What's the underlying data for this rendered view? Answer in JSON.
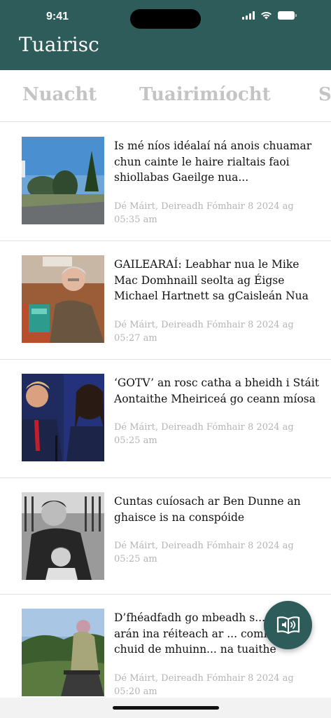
{
  "status": {
    "time": "9:41"
  },
  "header": {
    "title": "Tuairisc"
  },
  "tabs": [
    {
      "label": "Nuacht"
    },
    {
      "label": "Tuairimíocht"
    },
    {
      "label": "Sp"
    }
  ],
  "articles": [
    {
      "title": "Is mé níos idéalaí ná anois chuamar chun cainte le haire rialtais faoi shiollabas Gaeilge nua...",
      "date": "Dé Máirt, Deireadh Fómhair 8 2024 ag 05:35 am"
    },
    {
      "title": "GAILEARAÍ: Leabhar nua le Mike Mac Domhnaill seolta ag Éigse Michael Hartnett sa gCaisleán Nua",
      "date": "Dé Máirt, Deireadh Fómhair 8 2024 ag 05:27 am"
    },
    {
      "title": "‘GOTV’ an rosc catha a bheidh i Stáit Aontaithe Mheiriceá go ceann míosa",
      "date": "Dé Máirt, Deireadh Fómhair 8 2024 ag 05:25 am"
    },
    {
      "title": "Cuntas cuíosach ar Ben Dunne an ghaisce is na conspóide",
      "date": "Dé Máirt, Deireadh Fómhair 8 2024 ag 05:25 am"
    },
    {
      "title": "D’fhéadfadh go mbeadh s... agus arán ina réiteach ar ... comhluadair chuid de mhuinn... na tuaithe",
      "date": "Dé Máirt, Deireadh Fómhair 8 2024 ag 05:20 am"
    }
  ],
  "fab": {
    "icon": "book-audio-icon"
  },
  "colors": {
    "brand": "#2d5c5a",
    "tab_inactive": "#c4c4c4",
    "date": "#b4b4b4"
  }
}
